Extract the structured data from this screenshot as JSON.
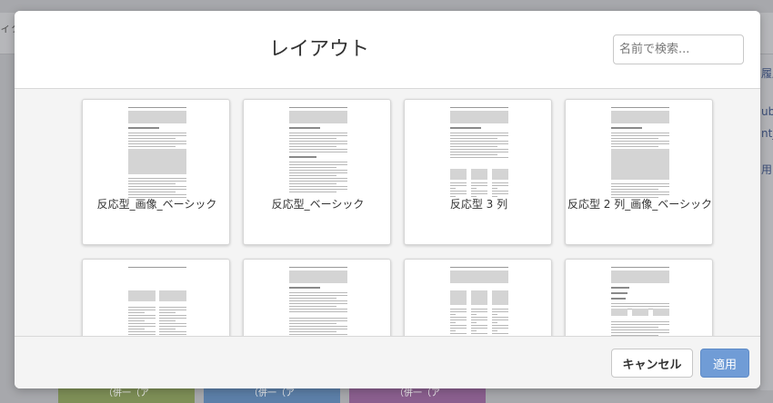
{
  "background": {
    "left_partial_text": "ィタ",
    "right_partial_texts": [
      "履历",
      "ubj",
      "nt_",
      "用"
    ],
    "bottom_tiles": [
      {
        "label": "（併一（ア",
        "color": "#7e8f57"
      },
      {
        "label": "（併一（ア",
        "color": "#5c7fa8"
      },
      {
        "label": "（併一（ア",
        "color": "#8a5f8e"
      }
    ]
  },
  "modal": {
    "title": "レイアウト",
    "search": {
      "placeholder": "名前で検索...",
      "value": ""
    },
    "layouts": [
      {
        "label": "反応型_画像_ベーシック",
        "variant": "image-basic"
      },
      {
        "label": "反応型_ベーシック",
        "variant": "basic"
      },
      {
        "label": "反応型 3 列",
        "variant": "three-column"
      },
      {
        "label": "反応型 2 列_画像_ベーシック",
        "variant": "two-column-image-basic"
      },
      {
        "label": "",
        "variant": "two-column"
      },
      {
        "label": "",
        "variant": "basic-images"
      },
      {
        "label": "",
        "variant": "three-column-images"
      },
      {
        "label": "",
        "variant": "headings"
      }
    ],
    "footer": {
      "cancel_label": "キャンセル",
      "apply_label": "適用"
    },
    "colors": {
      "apply_button": "#709cd6",
      "body_background": "#f4f4f4"
    }
  }
}
